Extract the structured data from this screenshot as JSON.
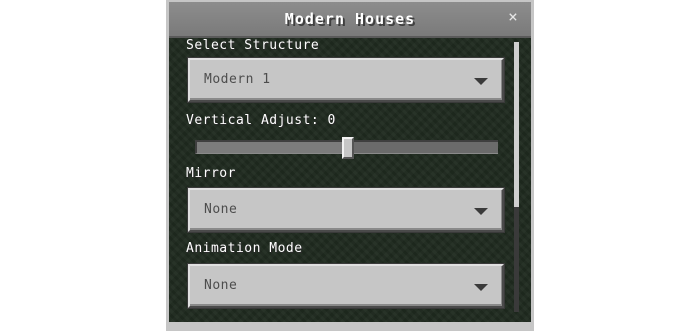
{
  "dialog": {
    "title": "Modern Houses",
    "close_symbol": "×",
    "close_icon": "close-icon"
  },
  "fields": {
    "structure": {
      "label": "Select Structure",
      "value": "Modern 1"
    },
    "vertical_adjust": {
      "label": "Vertical Adjust: 0",
      "value": 0,
      "position_fraction": 0.5
    },
    "mirror": {
      "label": "Mirror",
      "value": "None"
    },
    "animation_mode": {
      "label": "Animation Mode",
      "value": "None"
    }
  },
  "scrollbar": {
    "visible_fraction": 0.61,
    "scroll_position": 0
  },
  "colors": {
    "panel_background": "#1f2a1f",
    "control_gray": "#c6c6c6",
    "title_bar": "#8d8d8d",
    "label_text": "#ffffff",
    "value_text": "#4d4d4d"
  }
}
